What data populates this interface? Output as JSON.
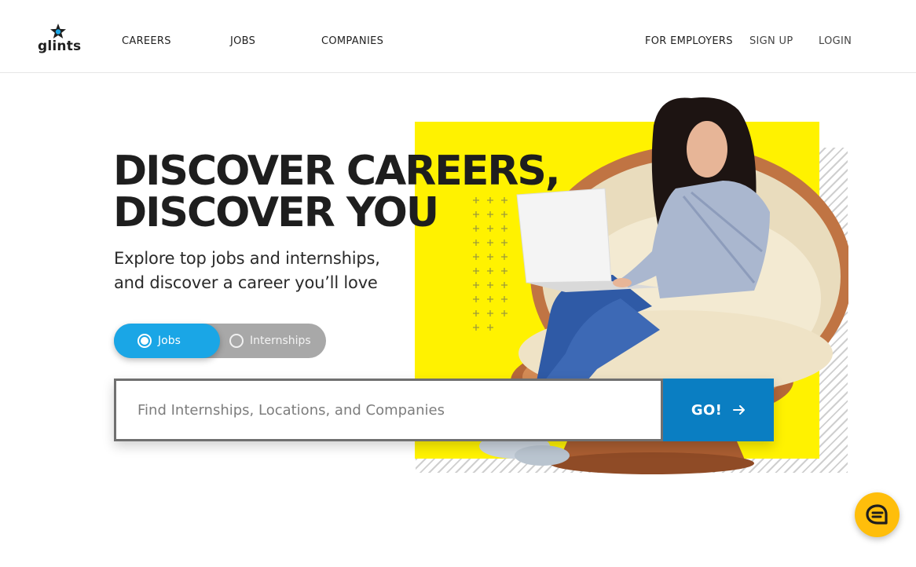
{
  "brand": {
    "name": "glints",
    "star_color": "#1e1e1e",
    "star_accent": "#1aa6e6"
  },
  "nav": {
    "left": [
      "CAREERS",
      "JOBS",
      "COMPANIES"
    ],
    "for_employers": "FOR EMPLOYERS",
    "sign_up": "SIGN UP",
    "login": "LOGIN"
  },
  "hero": {
    "headline_line1": "DISCOVER CAREERS,",
    "headline_line2": "DISCOVER YOU",
    "subline_line1": "Explore top jobs and internships,",
    "subline_line2": "and discover a career you’ll love"
  },
  "toggle": {
    "options": [
      {
        "label": "Jobs",
        "selected": true
      },
      {
        "label": "Internships",
        "selected": false
      }
    ]
  },
  "search": {
    "placeholder": "Find Internships, Locations, and Companies",
    "value": "",
    "button_label": "GO!",
    "button_icon": "arrow-right-icon"
  },
  "chat": {
    "icon": "chat-bubble-icon"
  },
  "colors": {
    "accent_blue": "#1aa6e6",
    "go_blue": "#0a7ec2",
    "yellow": "#fff200",
    "chat_yellow": "#ffbe0b"
  }
}
